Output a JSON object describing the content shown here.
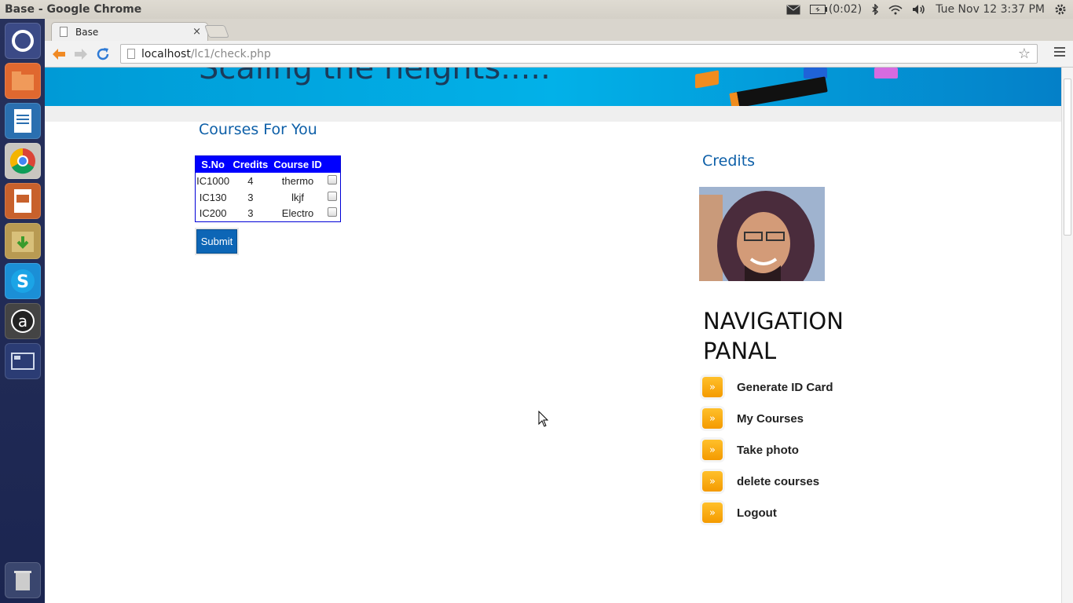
{
  "top_panel": {
    "title": "Base - Google Chrome",
    "battery": "(0:02)",
    "datetime": "Tue Nov 12  3:37 PM"
  },
  "launcher": {
    "icons": [
      "ubuntu-dash-icon",
      "files-icon",
      "writer-icon",
      "chrome-icon",
      "impress-icon",
      "archive-icon",
      "skype-icon",
      "amazon-icon",
      "workspace-icon",
      "trash-icon"
    ]
  },
  "browser": {
    "tab_title": "Base",
    "tab_close": "×",
    "url_host": "localhost",
    "url_path": "/lc1/check.php"
  },
  "page": {
    "banner_slogan": "Scaling the heights.....",
    "courses_title": "Courses For You",
    "table": {
      "headers": [
        "S.No",
        "Credits",
        "Course ID",
        ""
      ],
      "rows": [
        {
          "sno": "IC1000",
          "credits": "4",
          "course_id": "thermo"
        },
        {
          "sno": "IC130",
          "credits": "3",
          "course_id": "lkjf"
        },
        {
          "sno": "IC200",
          "credits": "3",
          "course_id": "Electro"
        }
      ]
    },
    "submit_label": "Submit",
    "credits_title": "Credits",
    "nav_title": "NAVIGATION PANAL",
    "nav_items": [
      {
        "label": "Generate ID Card"
      },
      {
        "label": "My Courses"
      },
      {
        "label": "Take photo"
      },
      {
        "label": "delete courses"
      },
      {
        "label": "Logout"
      }
    ]
  },
  "colors": {
    "accent": "#0d5fa8",
    "table_header": "#0000ff",
    "nav_arrow": "#f7a600"
  }
}
